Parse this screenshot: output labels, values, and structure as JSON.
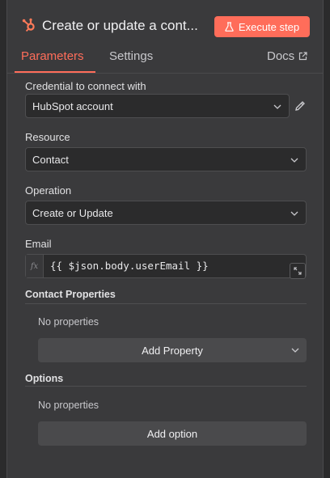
{
  "header": {
    "title": "Create or update a cont...",
    "node_icon": "hubspot-icon",
    "execute_label": "Execute step",
    "execute_icon": "flask-icon",
    "accent": "#ff6d5a"
  },
  "tabs": {
    "parameters": "Parameters",
    "settings": "Settings",
    "docs": "Docs",
    "docs_icon": "external-link-icon"
  },
  "fields": {
    "credential": {
      "label": "Credential to connect with",
      "value": "HubSpot account"
    },
    "resource": {
      "label": "Resource",
      "value": "Contact"
    },
    "operation": {
      "label": "Operation",
      "value": "Create or Update"
    },
    "email": {
      "label": "Email",
      "fx": "fx",
      "value": "{{ $json.body.userEmail }}"
    }
  },
  "contact_properties": {
    "title": "Contact Properties",
    "empty": "No properties",
    "add_label": "Add Property"
  },
  "options": {
    "title": "Options",
    "empty": "No properties",
    "add_label": "Add option"
  }
}
